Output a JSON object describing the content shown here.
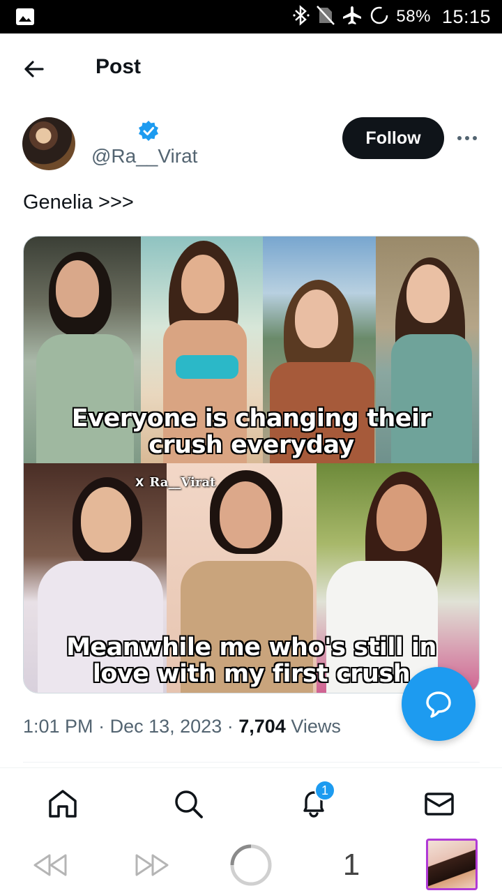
{
  "status_bar": {
    "battery": "58%",
    "time": "15:15",
    "icons": [
      "gallery-icon",
      "bluetooth-icon",
      "no-sim-icon",
      "airplane-icon",
      "loading-icon"
    ]
  },
  "header": {
    "title": "Post",
    "back_icon": "arrow-left-icon"
  },
  "author": {
    "handle": "@Ra__Virat",
    "verified": true,
    "follow_label": "Follow",
    "more_icon": "more-horizontal-icon"
  },
  "tweet": {
    "text": "Genelia >>>",
    "media": {
      "top_caption_line1": "Everyone is changing their",
      "top_caption_line2": "crush everyday",
      "watermark": "Ra__Virat",
      "watermark_prefix": "X",
      "bottom_caption_line1": "Meanwhile me who's still in",
      "bottom_caption_line2": "love with my first crush"
    },
    "time": "1:01 PM",
    "separator": "·",
    "date": "Dec 13, 2023",
    "views_count": "7,704",
    "views_label": "Views"
  },
  "nav": {
    "items": [
      {
        "name": "home",
        "icon": "home-icon"
      },
      {
        "name": "search",
        "icon": "search-icon"
      },
      {
        "name": "notifications",
        "icon": "bell-icon"
      },
      {
        "name": "messages",
        "icon": "mail-icon"
      }
    ],
    "notification_badge": "1"
  },
  "system_nav": {
    "tab_count": "1"
  },
  "colors": {
    "accent": "#1d9bf0",
    "text": "#0f1419",
    "muted": "#536471"
  }
}
